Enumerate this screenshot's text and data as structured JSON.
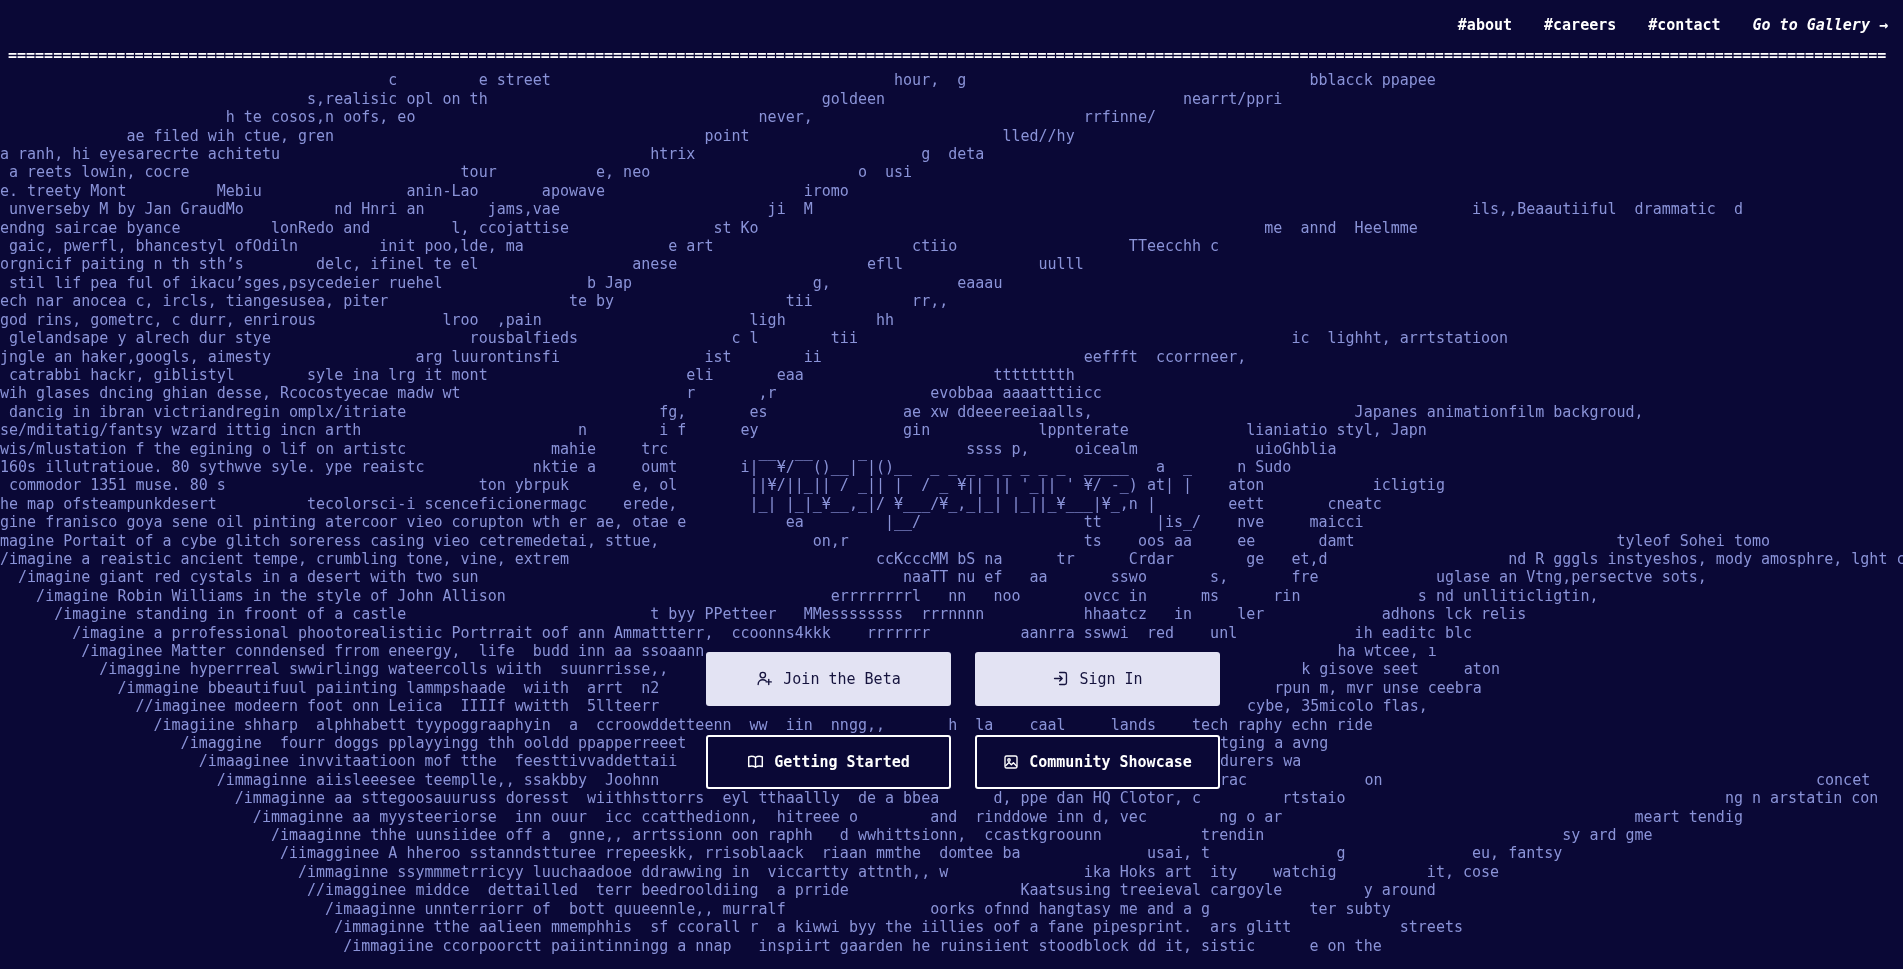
{
  "nav": {
    "links": [
      {
        "label": "#about"
      },
      {
        "label": "#careers"
      },
      {
        "label": "#contact"
      }
    ],
    "gallery_link": "Go to Gallery →"
  },
  "rule_text": "================================================================================================================================================================================================================",
  "background_lines": [
    "                                           c         e street                                      hour,  g                                      bblacck ppapee",
    "                                  s,realisic opl on th                                     goldeen                                 nearrt/ppri",
    "                         h te cosos,n oofs, eo                                      never,                              rrfinne/",
    "              ae filed wih ctue, gren                                         point                            lled//hy",
    "a ranh, hi eyesarecrte achitetu                                         htrix                         g  deta",
    " a reets lowin, cocre                              tour           e, neo                       o  usi",
    "e. treety Mont          Mebiu                anin-Lao       apowave                      iromo",
    " unverseby M by Jan GraudMo          nd Hnri an       jams,vae                       ji  M                                                                         ils,,Beaautiiful  drammatic  d",
    "endng saircae byance          lonRedo and         l, ccojattise                st Ko                                                        me  annd  Heelmme",
    " gaic, pwerfl, bhancestyl ofOdiln         init poo,lde, ma                e art                      ctiio                   TTeecchh c",
    "orgnicif paiting n th sth’s        delc, ifinel te el                 anese                     efll               uulll",
    " stil lif pea ful of ikacu’sges,psycedeier ruehel                b Jap                    g,              eaaau",
    "ech nar anocea c, ircls, tiangesusea, piter                    te by                   tii           rr,,",
    "god rins, gometrc, c durr, enrirous              lroo  ,pain                       ligh          hh",
    " glelandsape y alrech dur stye                      rousbalfieds                 c l        tii                                                ic  lighht, arrtstatioon",
    "jngle an haker,googls, aimesty                arg luurontinsfi                ist        ii                             eeffft  ccorrneer,",
    " catrabbi hackr, giblistyl        syle ina lrg it mont                      eli       eaa                     tttttttth",
    "wih glases dncing ghian desse, Rcocostyecae madw wt                         r       ,r                 evobbaa aaaatttiicc",
    " dancig in ibran victriandregin omplx/itriate                            fg,       es               ae xw ddeeereeiaalls,                             Japanes animationfilm backgroud,",
    "se/mditatig/fantsy wzard ittig incn arth                        n        i f      ey                gin            lppnterate             lianiatio styl, Japn",
    "wis/mlustation f the egining o lif on artistc                mahie     trc                                 ssss p,     oicealm             uioGhblia",
    "160s illutratioue. 80 sythwve syle. ype reaistc            nktie a     oumt       i|‾‾¥/‾‾()__|‾|()__  _ _ _ _ _ _ _ _  _____   a  _     n Sudo",
    " commodor 1351 muse. 80 s                            ton ybrpuk       e, ol        ||¥/||_|| / _|| |  / _ ¥|| || '_|| ' ¥/ -_) at| |    aton            icligtig",
    "he map ofsteampunkdesert          tecolorsci-i scenceficionermagc    erede,        |_| |_|_¥__,_|/ ¥___/¥_,_|_| |_||_¥___|¥_,n |        eett       cneatc",
    "gine franisco goya sene oil pinting atercoor vieo corupton wth er ae, otae e           ea         |__/                  tt      |is_/    nve     maicci",
    "magine Portait of a cybe glitch soreress casing vieo cetremedetai, sttue,                 on,r                          ts    oos aa     ee       damt                             tyleof Sohei tomo",
    "/imagine a reaistic ancient tempe, crumbling tone, vine, extrem                                  ccKcccMM bS na      tr      Crdar        ge   et,d                    nd R gggls instyeshos, mody amosphre, lght c",
    "  /imagine giant red cystals in a desert with two sun                                               naaTT nu ef   aa       sswo       s,       fre             uglase an Vtng,persectve sots,",
    "    /imagine Robin Williams in the style of John Allison                                    errrrrrrrl   nn   noo       ovcc in      ms      rin             s nd unlliticligtin,",
    "      /imagine standing in froont of a castle                           t byy PPetteer   MMessssssss  rrrnnnn           hhaatcz   in     ler             adhons lck relis",
    "        /imagine a prrofessional phootorealistiic Portrrait oof ann Ammattterr,  ccoonns4kkk    rrrrrrr          aanrra sswwi  red    unl             ih eaditc blc"
  ],
  "hero_top": {
    "left": [
      "         /imaginee Matter conndensed frrom eneergy,  life  budd inn aa ssoaann",
      "           /imaggine hyperrreal swwirlingg wateercolls wiith  suunrrisse,,",
      "             /immagine bbeautifuul paiinting lammpshaade  wiith  arrt  n2",
      "               //imaginee modeern foot onn Leiica  IIIIf wwitth  5llteerr"
    ],
    "buttons": [
      {
        "label": "Join the Beta",
        "kind": "light"
      },
      {
        "label": "Sign In",
        "kind": "light"
      }
    ],
    "right": [
      "             ha wtcee, ı",
      "         k gisove seet     aton",
      "      rpun m, mvr unse ceebra",
      "   cybe, 35micolo flas,"
    ]
  },
  "middle_line": "                 /imagiine shharp  alphhabett tyypoggraaphyin  a  ccroowddetteenn  ww  iin  nngg,,       h  la    caal     lands    tech raphy echn ride",
  "hero_bottom": {
    "left": [
      "                    /imaggine  fourr doggs pplayyingg thh ooldd ppapperreeet",
      "                      /imaaginee invvitaatioon mof tthe  feesttivvaddettaii",
      "                        /immaginne aiisleeesee teemplle,, ssakbby  Joohnn"
    ],
    "buttons": [
      {
        "label": "Getting Started",
        "kind": "dark"
      },
      {
        "label": "Community Showcase",
        "kind": "dark"
      }
    ],
    "right": [
      "tging a avng",
      "durers wa",
      "rac             on                                                concet"
    ]
  },
  "background_lines_after": [
    "                          /immaginne aa sttegoosauuruss doresst  wiithhsttorrs  eyl tthaallly  de a bbea      d, ppe dan HQ Clotor, c         rtstaio                                          ng n arstatin con",
    "                            /immaginne aa myysteeriorse  inn ouur  icc ccatthedionn,  hitreee o        and  rinddowe inn d, vec        ng o ar                                       meart tendig",
    "                              /imaaginne thhe uunsiidee off a  gnne,, arrtssionn oon raphh   d wwhittsionn,  ccastkgroounn           trendin                                 sy ard gme",
    "                               /iimagginee A hheroo sstanndstturee rrepeeskk, rrisoblaack  riaan mmthe  domtee ba              usai, t              g              eu, fantsy",
    "                                 /immaginne ssymmmetrricyy luuchaadooe ddrawwing in  viccartty attnth,, w               ika Hoks art  ity    watchig          it, cose",
    "                                  //imagginee middce  dettailled  terr beedrooldiing  a prride                   Kaatsusing treeieval cargoyle         y around",
    "                                    /imaaginne unnterriorr of  bott quueennle,, murralf                oorks ofnnd hangtasy me and a g           ter subty",
    "                                     /immaginne tthe aalieen mmemphhis  sf ccorall r  a kiwwi byy the iillies oof a fane pipesprint.  ars glitt            streets",
    "                                      /immagiine ccorpoorctt paiintinningg a nnap   inspiirt gaarden he ruinsiient stoodblock dd it, sistic      e on the"
  ]
}
